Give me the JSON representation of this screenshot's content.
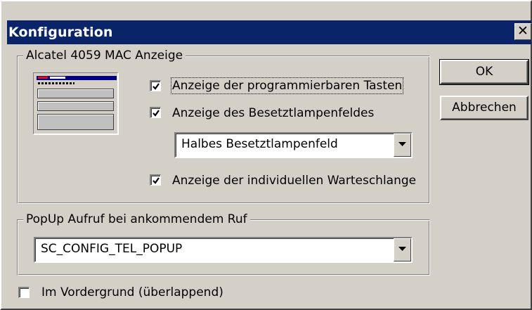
{
  "dialog": {
    "title": "Konfiguration",
    "close_glyph": "✕",
    "title_bar_color": "#0a246a"
  },
  "groups": {
    "display": {
      "label": "Alcatel 4059 MAC Anzeige",
      "options": [
        {
          "label": "Anzeige der programmierbaren Tasten",
          "checked": true
        },
        {
          "label": "Anzeige des Besetztlampenfeldes",
          "checked": true
        },
        {
          "label": "Anzeige der individuellen Warteschlange",
          "checked": true
        }
      ],
      "lamp_field_select": {
        "value": "Halbes Besetztlampenfeld"
      }
    },
    "popup": {
      "label": "PopUp Aufruf bei ankommendem Ruf",
      "select": {
        "value": "SC_CONFIG_TEL_POPUP"
      }
    }
  },
  "foreground_option": {
    "label": "Im Vordergrund (überlappend)",
    "checked": false
  },
  "buttons": {
    "ok": "OK",
    "cancel": "Abbrechen"
  },
  "icons": {
    "checkmark": "check-icon",
    "dropdown": "chevron-down-icon",
    "preview": "layout-preview-icon"
  }
}
